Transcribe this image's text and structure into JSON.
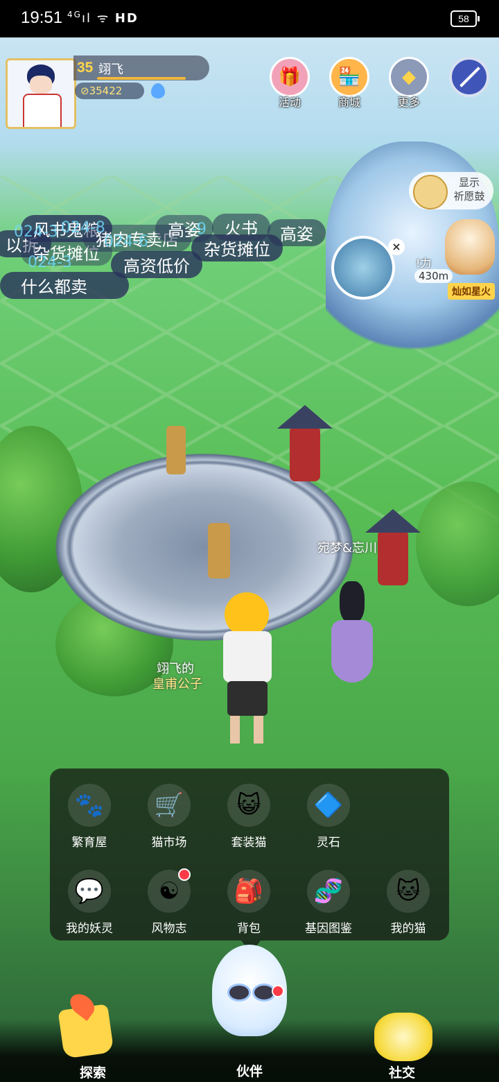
{
  "status_bar": {
    "time": "19:51",
    "network": "4G",
    "signal_text": "ıl",
    "wifi_text": "ᯤ",
    "hd": "HD",
    "battery": "58"
  },
  "player": {
    "level": "35",
    "name": "翊飞",
    "coins": "35422"
  },
  "top_menu": {
    "activity": "活动",
    "shop": "商城",
    "more": "更多"
  },
  "stalls": {
    "s1": "风书鬼粮",
    "s1b": "杂货摊位",
    "s2": "猪肉专卖店",
    "s3": "高姿",
    "s4": "火书",
    "s5": "杂货摊位",
    "s6": "高姿",
    "s7": "高资低价",
    "s8": "什么都卖",
    "s9": "以拆",
    "id1": "024-8",
    "id2": "024-3",
    "id3": "024-6",
    "id4": "024-3",
    "id5": "-9"
  },
  "wish": {
    "line1": "显示",
    "line2": "祈愿鼓"
  },
  "poi": {
    "name_fragment": "!力",
    "distance": "430m",
    "badge": "灿如星火",
    "close": "×"
  },
  "scene": {
    "npc_label": "宛梦&忘川",
    "pet_owner": "翊飞的",
    "pet_title": "皇甫公子"
  },
  "menu": {
    "row1": [
      {
        "label": "繁育屋",
        "icon": "🐾"
      },
      {
        "label": "猫市场",
        "icon": "🛒"
      },
      {
        "label": "套装猫",
        "icon": "😺"
      },
      {
        "label": "灵石",
        "icon": "🔷"
      }
    ],
    "row2": [
      {
        "label": "我的妖灵",
        "icon": "💬"
      },
      {
        "label": "风物志",
        "icon": "☯"
      },
      {
        "label": "背包",
        "icon": "🎒"
      },
      {
        "label": "基因图鉴",
        "icon": "🧬"
      },
      {
        "label": "我的猫",
        "icon": "🐱"
      }
    ]
  },
  "nav": {
    "explore": "探索",
    "partner": "伙伴",
    "social": "社交"
  },
  "colors": {
    "accent_gold": "#ffd44a",
    "notify_red": "#ff3b48",
    "grass": "#58bd55"
  }
}
